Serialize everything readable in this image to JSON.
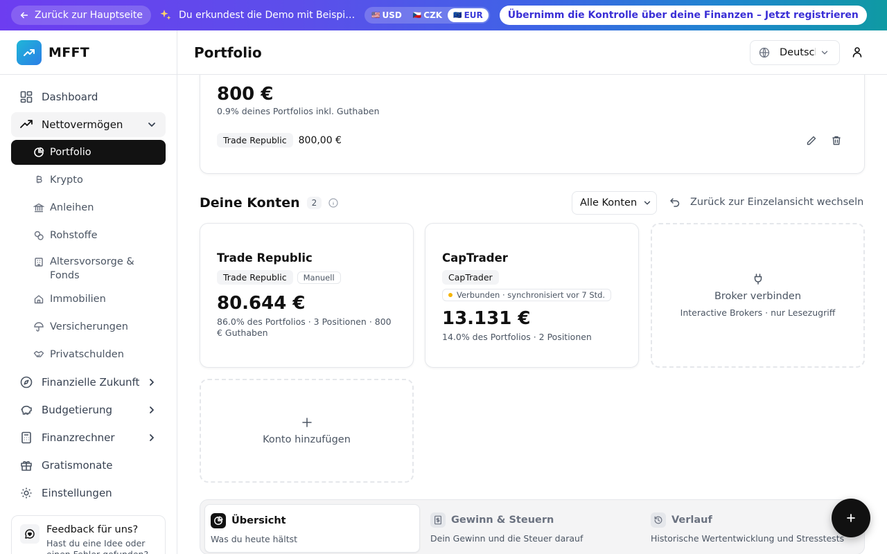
{
  "banner": {
    "back_label": "Zurück zur Hauptseite",
    "demo_text": "Du erkundest die Demo mit Beispieldaten",
    "currencies": [
      {
        "flag": "🇺🇸",
        "code": "USD",
        "active": false
      },
      {
        "flag": "🇨🇿",
        "code": "CZK",
        "active": false
      },
      {
        "flag": "🇪🇺",
        "code": "EUR",
        "active": true
      }
    ],
    "register_label": "Übernimm die Kontrolle über deine Finanzen – Jetzt registrieren"
  },
  "sidebar": {
    "brand": "MFFT",
    "items": [
      {
        "label": "Dashboard"
      },
      {
        "label": "Nettovermögen"
      },
      {
        "label": "Finanzielle Zukunft"
      },
      {
        "label": "Budgetierung"
      },
      {
        "label": "Finanzrechner"
      },
      {
        "label": "Gratismonate"
      },
      {
        "label": "Einstellungen"
      }
    ],
    "subitems": [
      {
        "label": "Portfolio"
      },
      {
        "label": "Krypto"
      },
      {
        "label": "Anleihen"
      },
      {
        "label": "Rohstoffe"
      },
      {
        "label": "Altersvorsorge & Fonds"
      },
      {
        "label": "Immobilien"
      },
      {
        "label": "Versicherungen"
      },
      {
        "label": "Privatschulden"
      }
    ],
    "feedback": {
      "title": "Feedback für uns?",
      "text": "Hast du eine Idee oder einen Fehler gefunden?"
    }
  },
  "header": {
    "title": "Portfolio",
    "language": "Deutsch"
  },
  "cash": {
    "amount": "800 €",
    "subtitle": "0.9% deines Portfolios inkl. Guthaben",
    "broker": "Trade Republic",
    "value": "800,00 €"
  },
  "accounts": {
    "title": "Deine Konten",
    "count": "2",
    "filter": "Alle Konten",
    "switch_view": "Zurück zur Einzelansicht wechseln",
    "cards": [
      {
        "name": "Trade Republic",
        "tag": "Trade Republic",
        "mode": "Manuell",
        "value": "80.644 €",
        "subtitle": "86.0% des Portfolios · 3 Positionen · 800 € Guthaben"
      },
      {
        "name": "CapTrader",
        "tag": "CapTrader",
        "status": "Verbunden · synchronisiert vor 7 Std.",
        "value": "13.131 €",
        "subtitle": "14.0% des Portfolios · 2 Positionen"
      }
    ],
    "connect": {
      "title": "Broker verbinden",
      "subtitle": "Interactive Brokers · nur Lesezugriff"
    },
    "add": {
      "title": "Konto hinzufügen"
    }
  },
  "tabs": [
    {
      "label": "Übersicht",
      "desc": "Was du heute hältst",
      "active": true
    },
    {
      "label": "Gewinn & Steuern",
      "desc": "Dein Gewinn und die Steuer darauf",
      "active": false
    },
    {
      "label": "Verlauf",
      "desc": "Historische Wertentwicklung und Stresstests",
      "active": false
    }
  ],
  "colors": {
    "banner_start": "#6d3df0",
    "banner_end": "#0f9aa3",
    "active_nav": "#121212",
    "status_dot": "#f5b400"
  }
}
